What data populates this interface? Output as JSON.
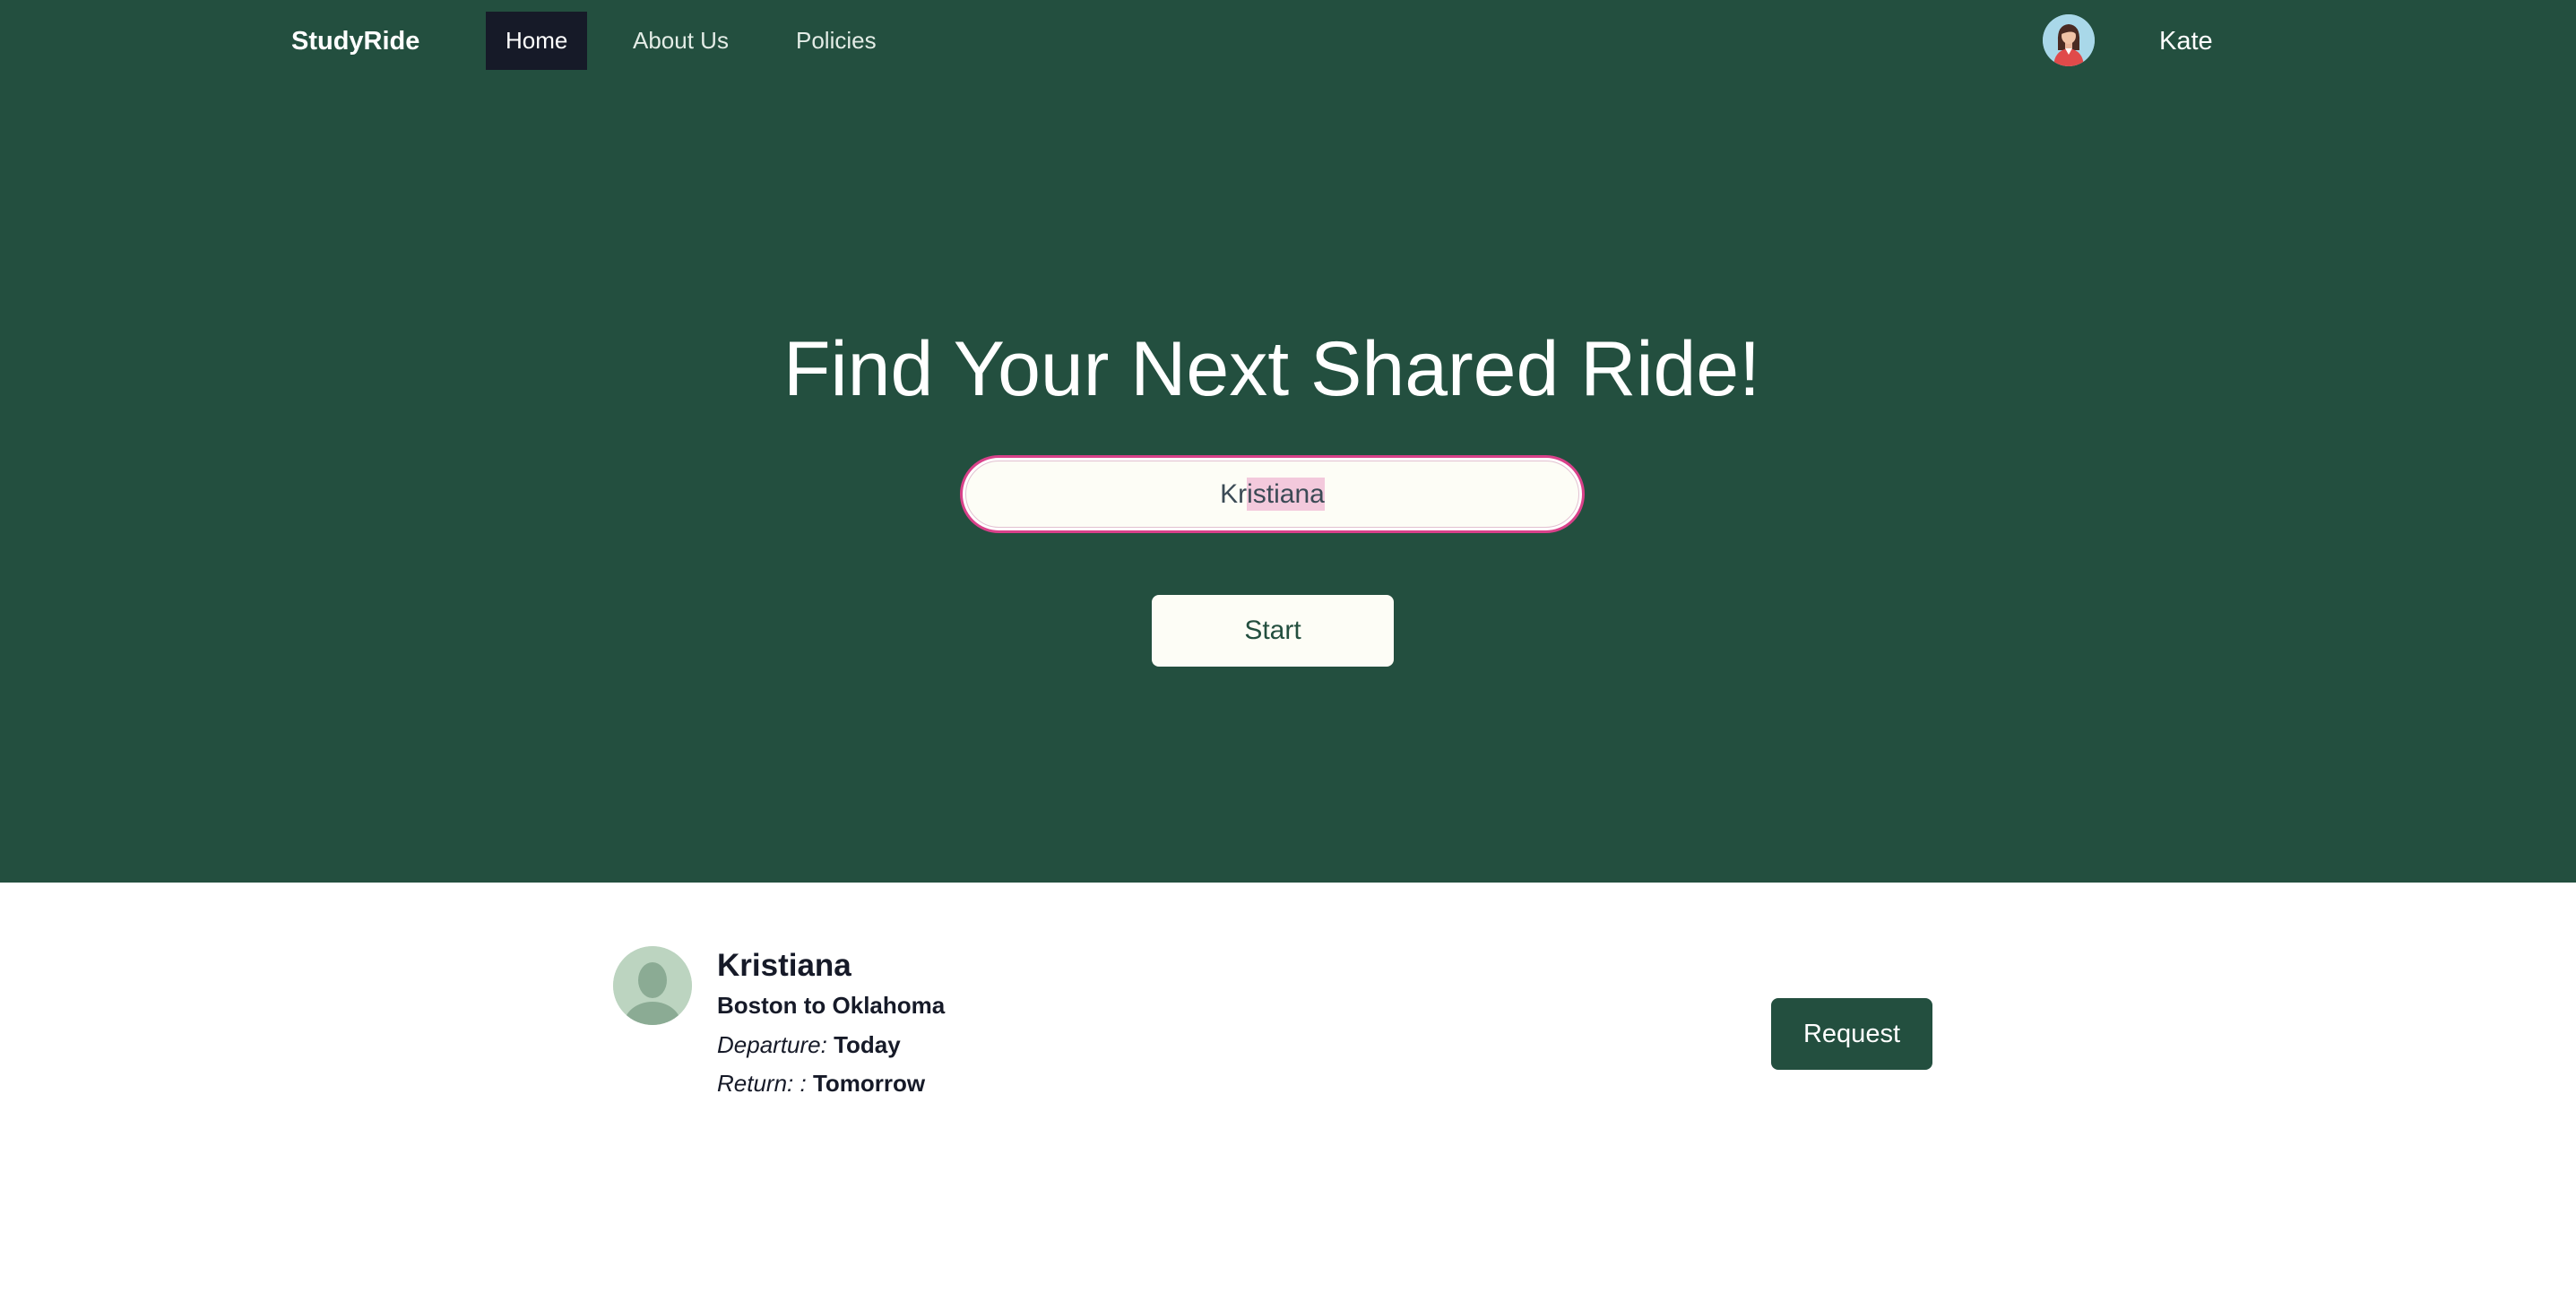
{
  "nav": {
    "brand": "StudyRide",
    "items": [
      {
        "label": "Home",
        "active": true
      },
      {
        "label": "About Us",
        "active": false
      },
      {
        "label": "Policies",
        "active": false
      }
    ],
    "user": {
      "name": "Kate",
      "avatar_icon": "user-avatar-icon"
    }
  },
  "hero": {
    "title": "Find Your Next Shared Ride!",
    "search": {
      "value_prefix": "Kr",
      "value_selected": "istiana"
    },
    "start_label": "Start"
  },
  "results": [
    {
      "name": "Kristiana",
      "route": "Boston to Oklahoma",
      "departure_label": "Departure:",
      "departure_value": "Today",
      "return_label": "Return: :",
      "return_value": "Tomorrow",
      "request_label": "Request",
      "avatar_icon": "default-avatar-icon"
    }
  ],
  "colors": {
    "primary": "#234f3f",
    "nav_active": "#161a28",
    "search_focus": "#d9418a",
    "text_selection": "#f3c9dc"
  }
}
